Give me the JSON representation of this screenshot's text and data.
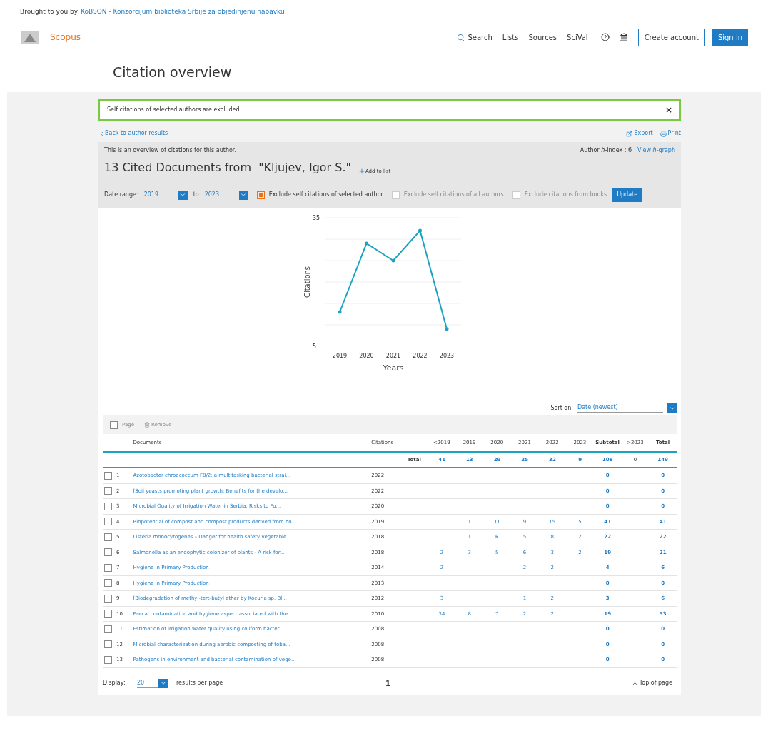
{
  "banner": {
    "prefix": "Brought to you by",
    "link": "KoBSON - Konzorcijum biblioteka Srbije za objedinjenu nabavku"
  },
  "header": {
    "brand": "Scopus",
    "nav": [
      "Search",
      "Lists",
      "Sources",
      "SciVal"
    ],
    "create_account": "Create account",
    "sign_in": "Sign in"
  },
  "page_title": "Citation overview",
  "alert": {
    "text": "Self citations of selected authors are excluded.",
    "close": "×"
  },
  "back_link": "Back to author results",
  "actions": [
    "Export",
    "Print"
  ],
  "overview": {
    "intro": "This is an overview of citations for this author.",
    "h_index_label": "Author *h*-index : 6",
    "h_graph": "View *h*-graph",
    "heading": "13 Cited Documents from  \"Kljujev, Igor S.\"",
    "add_to_list": "Add to list"
  },
  "filters": {
    "date_label": "Date range:",
    "from": "2019",
    "to_label": "to",
    "to": "2023",
    "update": "Update",
    "options": [
      {
        "label": "Exclude self citations of selected author",
        "checked": true,
        "disabled": false
      },
      {
        "label": "Exclude self citations of all authors",
        "checked": false,
        "disabled": true
      },
      {
        "label": "Exclude citations from books",
        "checked": false,
        "disabled": true
      }
    ]
  },
  "chart": {
    "chart_data": {
      "type": "line",
      "xlabel": "Years",
      "ylabel": "Citations",
      "categories": [
        "2019",
        "2020",
        "2021",
        "2022",
        "2023"
      ],
      "series": [
        {
          "color": "#1ba3c0",
          "values": [
            13,
            29,
            25,
            32,
            9
          ]
        }
      ],
      "ylim": [
        5,
        35
      ],
      "yticks": [
        5,
        35
      ]
    }
  },
  "sort": {
    "label": "Sort on:",
    "value": "Date (newest)"
  },
  "toolbar": {
    "page_label": "Page",
    "page_checked": false,
    "remove": "Remove"
  },
  "table": {
    "documents_header": "Documents",
    "year_header": "Citations",
    "columns": [
      "<2019",
      "2019",
      "2020",
      "2021",
      "2022",
      "2023",
      "Subtotal",
      ">2023",
      "Total"
    ],
    "total_label": "Total",
    "totals": [
      "41",
      "13",
      "29",
      "25",
      "32",
      "9",
      "108",
      "0",
      "149"
    ],
    "rows": [
      {
        "num": "1",
        "title": "Azotobacter chroococcum F8/2: a multitasking bacterial strai...",
        "year": "2022",
        "checked": false,
        "cells": [
          null,
          null,
          null,
          null,
          null,
          null,
          "0",
          null,
          "0"
        ]
      },
      {
        "num": "2",
        "title": "[Soil yeasts promoting plant growth: Benefits for the develo...",
        "year": "2022",
        "checked": false,
        "cells": [
          null,
          null,
          null,
          null,
          null,
          null,
          "0",
          null,
          "0"
        ]
      },
      {
        "num": "3",
        "title": "Microbial Quality of Irrigation Water in Serbia: Risks to Fo...",
        "year": "2020",
        "checked": false,
        "cells": [
          null,
          null,
          null,
          null,
          null,
          null,
          "0",
          null,
          "0"
        ]
      },
      {
        "num": "4",
        "title": "Biopotential of compost and compost products derived from ho...",
        "year": "2019",
        "checked": false,
        "cells": [
          null,
          "1",
          "11",
          "9",
          "15",
          "5",
          "41",
          null,
          "41"
        ]
      },
      {
        "num": "5",
        "title": "Listeria monocytogenes – Danger for health safety vegetable ...",
        "year": "2018",
        "checked": false,
        "cells": [
          null,
          "1",
          "6",
          "5",
          "8",
          "2",
          "22",
          null,
          "22"
        ]
      },
      {
        "num": "6",
        "title": "Salmonella as an endophytic colonizer of plants - A risk for...",
        "year": "2018",
        "checked": false,
        "cells": [
          "2",
          "3",
          "5",
          "6",
          "3",
          "2",
          "19",
          null,
          "21"
        ]
      },
      {
        "num": "7",
        "title": "Hygiene in Primary Production",
        "year": "2014",
        "checked": false,
        "cells": [
          "2",
          null,
          null,
          "2",
          "2",
          null,
          "4",
          null,
          "6"
        ]
      },
      {
        "num": "8",
        "title": "Hygiene in Primary Production",
        "year": "2013",
        "checked": false,
        "cells": [
          null,
          null,
          null,
          null,
          null,
          null,
          "0",
          null,
          "0"
        ]
      },
      {
        "num": "9",
        "title": "[Biodegradation of methyl-tert-butyl ether by Kocuria sp. Bl...",
        "year": "2012",
        "checked": false,
        "cells": [
          "3",
          null,
          null,
          "1",
          "2",
          null,
          "3",
          null,
          "6"
        ]
      },
      {
        "num": "10",
        "title": "Faecal contamination and hygiene aspect associated with the ...",
        "year": "2010",
        "checked": false,
        "cells": [
          "34",
          "8",
          "7",
          "2",
          "2",
          null,
          "19",
          null,
          "53"
        ]
      },
      {
        "num": "11",
        "title": "Estimation of irrigation water quality using coliform bacter...",
        "year": "2008",
        "checked": false,
        "cells": [
          null,
          null,
          null,
          null,
          null,
          null,
          "0",
          null,
          "0"
        ]
      },
      {
        "num": "12",
        "title": "Microbial characterization during aerobic composting of toba...",
        "year": "2008",
        "checked": false,
        "cells": [
          null,
          null,
          null,
          null,
          null,
          null,
          "0",
          null,
          "0"
        ]
      },
      {
        "num": "13",
        "title": "Pathogens in environment and bacterial contamination of vege...",
        "year": "2008",
        "checked": false,
        "cells": [
          null,
          null,
          null,
          null,
          null,
          null,
          "0",
          null,
          "0"
        ]
      }
    ]
  },
  "footer": {
    "display_label": "Display:",
    "display_value": "20",
    "per_page": "results per page",
    "page": "1",
    "top": "Top of page"
  }
}
